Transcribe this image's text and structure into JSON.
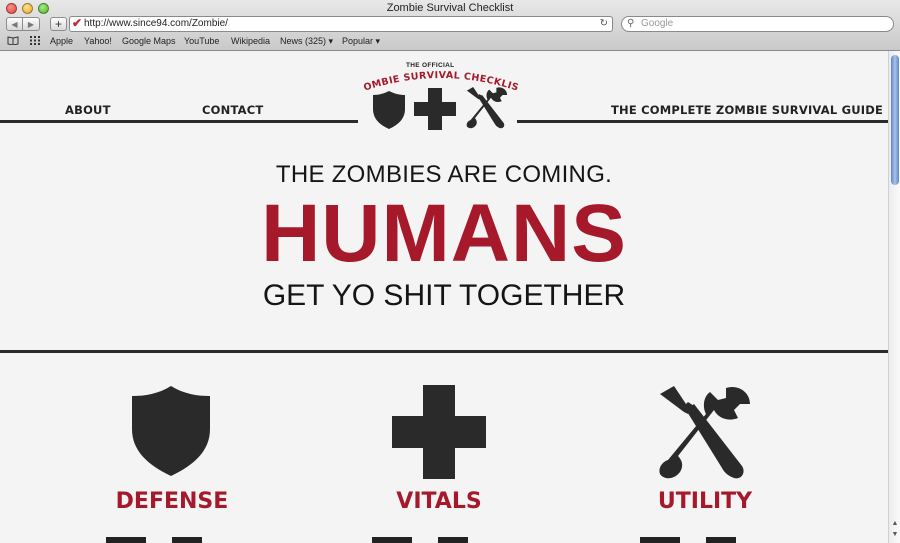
{
  "window": {
    "title": "Zombie Survival Checklist"
  },
  "toolbar": {
    "url": "http://www.since94.com/Zombie/",
    "search_placeholder": "Google",
    "back": "◀",
    "forward": "▶",
    "add": "+",
    "reload": "↻"
  },
  "bookmarks": [
    "Apple",
    "Yahoo!",
    "Google Maps",
    "YouTube",
    "Wikipedia",
    "News (325) ▾",
    "Popular ▾"
  ],
  "site_nav": {
    "about": "ABOUT",
    "contact": "CONTACT",
    "guide": "THE COMPLETE ZOMBIE SURVIVAL GUIDE"
  },
  "logo": {
    "small": "THE OFFICIAL",
    "title": "ZOMBIE SURVIVAL CHECKLIST"
  },
  "hero": {
    "line1": "THE ZOMBIES ARE COMING.",
    "line2": "HUMANS",
    "line3": "GET YO SHIT TOGETHER"
  },
  "categories": [
    {
      "label": "DEFENSE",
      "icon": "shield-icon"
    },
    {
      "label": "VITALS",
      "icon": "cross-icon"
    },
    {
      "label": "UTILITY",
      "icon": "tools-icon"
    }
  ],
  "colors": {
    "accent": "#a5192a",
    "dark": "#2a2a2a",
    "background": "#f4f4f4"
  }
}
